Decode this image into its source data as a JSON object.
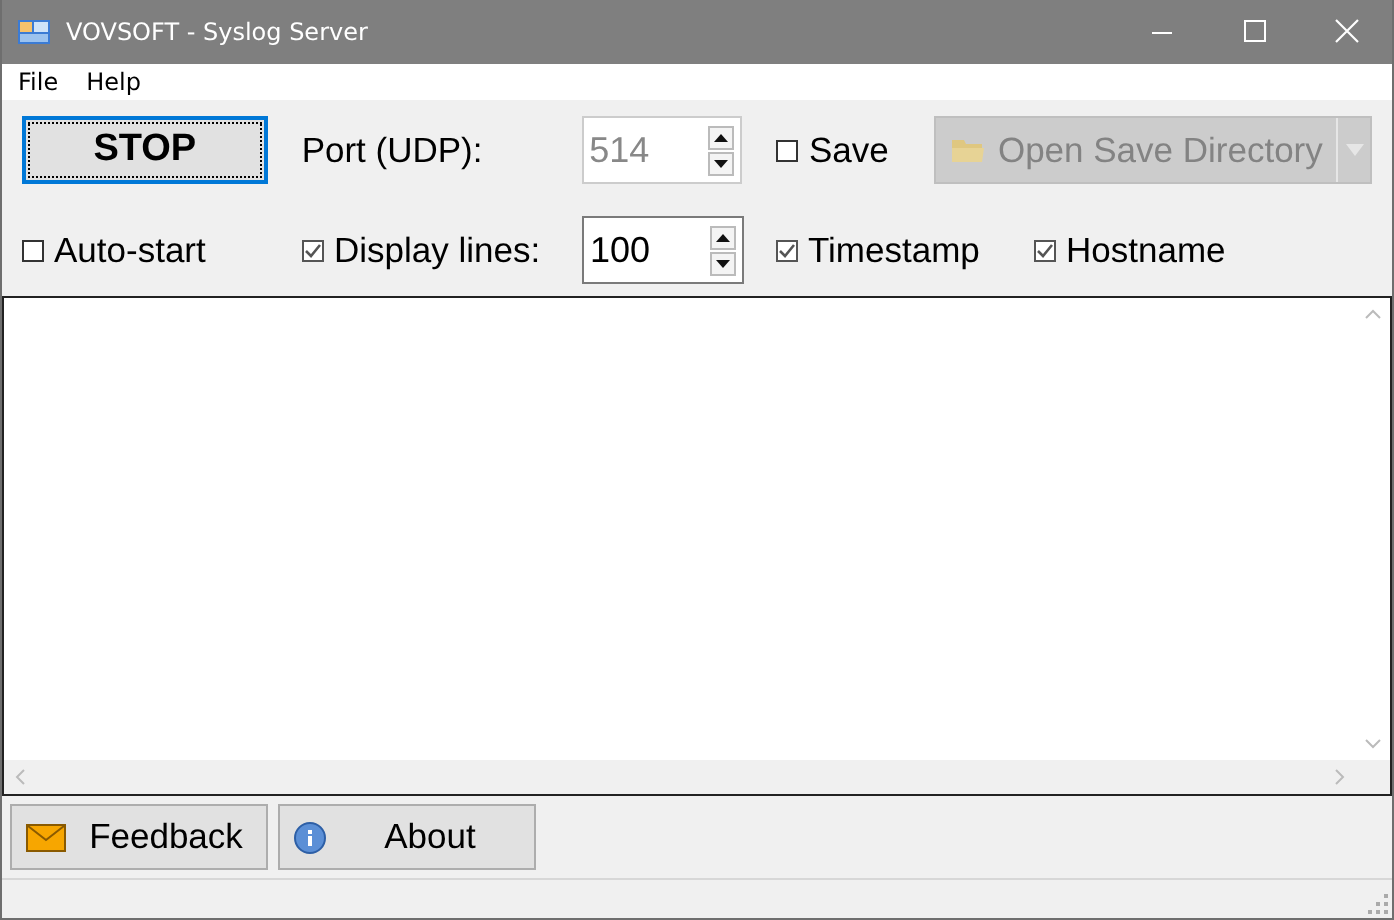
{
  "window": {
    "title": "VOVSOFT - Syslog Server"
  },
  "menu": [
    {
      "label": "File"
    },
    {
      "label": "Help"
    }
  ],
  "stop_button": {
    "label": "STOP"
  },
  "port": {
    "label": "Port (UDP):",
    "value": "514",
    "disabled": true
  },
  "save": {
    "label": "Save",
    "checked": false
  },
  "open_save_directory": {
    "label": "Open Save Directory",
    "disabled": true
  },
  "auto_start": {
    "label": "Auto-start",
    "checked": false
  },
  "display_lines": {
    "label": "Display lines:",
    "checked": true,
    "value": "100",
    "disabled": false
  },
  "timestamp": {
    "label": "Timestamp",
    "checked": true
  },
  "hostname": {
    "label": "Hostname",
    "checked": true
  },
  "buttons": [
    {
      "kind": "feedback",
      "label": "Feedback"
    },
    {
      "kind": "about",
      "label": "About"
    }
  ]
}
